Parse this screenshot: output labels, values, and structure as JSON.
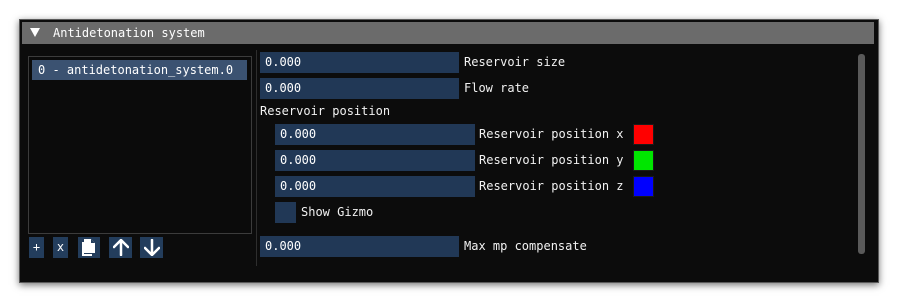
{
  "window": {
    "title": "Antidetonation system"
  },
  "list": {
    "items": [
      "0 - antidetonation_system.0"
    ]
  },
  "list_buttons": {
    "add": "+",
    "remove": "x"
  },
  "properties": {
    "reservoir_size": {
      "value": "0.000",
      "label": "Reservoir size"
    },
    "flow_rate": {
      "value": "0.000",
      "label": "Flow rate"
    },
    "reservoir_position_header": "Reservoir position",
    "reservoir_position_x": {
      "value": "0.000",
      "label": "Reservoir position x",
      "color": "#ff0000"
    },
    "reservoir_position_y": {
      "value": "0.000",
      "label": "Reservoir position y",
      "color": "#00e600"
    },
    "reservoir_position_z": {
      "value": "0.000",
      "label": "Reservoir position z",
      "color": "#0000ff"
    },
    "show_gizmo": {
      "label": "Show Gizmo",
      "checked": false
    },
    "max_mp_compensate": {
      "value": "0.000",
      "label": "Max mp compensate"
    }
  }
}
